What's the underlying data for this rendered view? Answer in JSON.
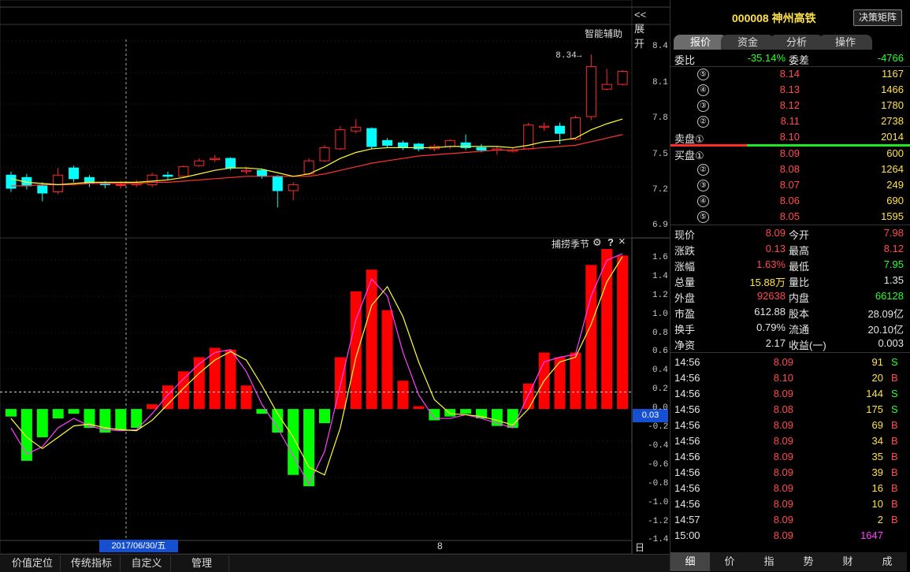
{
  "top_panel": {
    "expand_label": "<<展开",
    "assist_label": "智能辅助",
    "high_marker": "8.34"
  },
  "indicator": {
    "name": "捕捞季节",
    "gear_icon": "gear-icon",
    "help": "?",
    "close": "×",
    "current_value": "0.03"
  },
  "date_label": "2017/06/30/五",
  "axis_mid_label": "8",
  "period_label": "日 线",
  "bottom_tabs": [
    "价值定位",
    "传统指标",
    "自定义",
    "管理"
  ],
  "chart_data": [
    {
      "type": "candlestick",
      "y_ticks": [
        "8.4",
        "8.1",
        "7.8",
        "7.5",
        "7.2",
        "6.9"
      ],
      "ylim": [
        6.85,
        8.5
      ],
      "annotation": "8.34",
      "candles": [
        {
          "o": 7.33,
          "c": 7.22,
          "h": 7.36,
          "l": 7.19
        },
        {
          "o": 7.31,
          "c": 7.24,
          "h": 7.34,
          "l": 7.21
        },
        {
          "o": 7.24,
          "c": 7.18,
          "h": 7.27,
          "l": 7.11
        },
        {
          "o": 7.19,
          "c": 7.33,
          "h": 7.39,
          "l": 7.17
        },
        {
          "o": 7.39,
          "c": 7.3,
          "h": 7.41,
          "l": 7.27
        },
        {
          "o": 7.31,
          "c": 7.26,
          "h": 7.33,
          "l": 7.23
        },
        {
          "o": 7.26,
          "c": 7.25,
          "h": 7.28,
          "l": 7.22
        },
        {
          "o": 7.25,
          "c": 7.25,
          "h": 7.28,
          "l": 7.22
        },
        {
          "o": 7.25,
          "c": 7.26,
          "h": 7.29,
          "l": 7.23
        },
        {
          "o": 7.25,
          "c": 7.33,
          "h": 7.35,
          "l": 7.23
        },
        {
          "o": 7.33,
          "c": 7.32,
          "h": 7.36,
          "l": 7.29
        },
        {
          "o": 7.32,
          "c": 7.4,
          "h": 7.41,
          "l": 7.31
        },
        {
          "o": 7.41,
          "c": 7.45,
          "h": 7.47,
          "l": 7.4
        },
        {
          "o": 7.46,
          "c": 7.47,
          "h": 7.5,
          "l": 7.44
        },
        {
          "o": 7.47,
          "c": 7.39,
          "h": 7.48,
          "l": 7.37
        },
        {
          "o": 7.36,
          "c": 7.37,
          "h": 7.4,
          "l": 7.34
        },
        {
          "o": 7.37,
          "c": 7.32,
          "h": 7.38,
          "l": 7.3
        },
        {
          "o": 7.32,
          "c": 7.2,
          "h": 7.33,
          "l": 7.06
        },
        {
          "o": 7.2,
          "c": 7.25,
          "h": 7.27,
          "l": 7.12
        },
        {
          "o": 7.34,
          "c": 7.45,
          "h": 7.47,
          "l": 7.33
        },
        {
          "o": 7.45,
          "c": 7.56,
          "h": 7.58,
          "l": 7.44
        },
        {
          "o": 7.55,
          "c": 7.71,
          "h": 7.74,
          "l": 7.54
        },
        {
          "o": 7.7,
          "c": 7.73,
          "h": 7.8,
          "l": 7.68
        },
        {
          "o": 7.72,
          "c": 7.57,
          "h": 7.73,
          "l": 7.55
        },
        {
          "o": 7.62,
          "c": 7.58,
          "h": 7.64,
          "l": 7.56
        },
        {
          "o": 7.6,
          "c": 7.56,
          "h": 7.62,
          "l": 7.54
        },
        {
          "o": 7.59,
          "c": 7.55,
          "h": 7.6,
          "l": 7.53
        },
        {
          "o": 7.55,
          "c": 7.57,
          "h": 7.59,
          "l": 7.53
        },
        {
          "o": 7.57,
          "c": 7.62,
          "h": 7.63,
          "l": 7.55
        },
        {
          "o": 7.6,
          "c": 7.56,
          "h": 7.67,
          "l": 7.54
        },
        {
          "o": 7.56,
          "c": 7.54,
          "h": 7.59,
          "l": 7.52
        },
        {
          "o": 7.54,
          "c": 7.55,
          "h": 7.57,
          "l": 7.5
        },
        {
          "o": 7.53,
          "c": 7.54,
          "h": 7.56,
          "l": 7.52
        },
        {
          "o": 7.55,
          "c": 7.75,
          "h": 7.77,
          "l": 7.54
        },
        {
          "o": 7.73,
          "c": 7.74,
          "h": 7.77,
          "l": 7.7
        },
        {
          "o": 7.74,
          "c": 7.68,
          "h": 7.77,
          "l": 7.59
        },
        {
          "o": 7.63,
          "c": 7.81,
          "h": 7.83,
          "l": 7.62
        },
        {
          "o": 7.82,
          "c": 8.24,
          "h": 8.34,
          "l": 7.79
        },
        {
          "o": 8.05,
          "c": 8.09,
          "h": 8.22,
          "l": 8.04
        },
        {
          "o": 8.09,
          "c": 8.2,
          "h": 8.21,
          "l": 8.08
        }
      ],
      "ma_short": [
        7.3,
        7.27,
        7.26,
        7.25,
        7.26,
        7.27,
        7.27,
        7.27,
        7.27,
        7.28,
        7.29,
        7.31,
        7.34,
        7.37,
        7.39,
        7.39,
        7.38,
        7.35,
        7.32,
        7.34,
        7.4,
        7.47,
        7.52,
        7.55,
        7.56,
        7.56,
        7.56,
        7.56,
        7.57,
        7.57,
        7.57,
        7.57,
        7.56,
        7.58,
        7.61,
        7.62,
        7.64,
        7.71,
        7.76,
        7.8
      ],
      "ma_long": [
        7.24,
        7.24,
        7.25,
        7.25,
        7.25,
        7.26,
        7.26,
        7.26,
        7.26,
        7.27,
        7.27,
        7.28,
        7.29,
        7.3,
        7.31,
        7.32,
        7.32,
        7.32,
        7.32,
        7.32,
        7.34,
        7.37,
        7.4,
        7.43,
        7.45,
        7.47,
        7.49,
        7.5,
        7.51,
        7.52,
        7.53,
        7.54,
        7.54,
        7.55,
        7.56,
        7.57,
        7.58,
        7.61,
        7.64,
        7.67
      ]
    },
    {
      "type": "bar",
      "y_ticks": [
        "1.6",
        "1.4",
        "1.2",
        "1.0",
        "0.8",
        "0.6",
        "0.4",
        "0.2",
        "0.0",
        "-0.2",
        "-0.4",
        "-0.6",
        "-0.8",
        "-1.0",
        "-1.2",
        "-1.4"
      ],
      "ylim": [
        -1.43,
        1.75
      ],
      "reference_line": 0.18,
      "values": [
        -0.08,
        -0.55,
        -0.3,
        -0.1,
        -0.05,
        -0.2,
        -0.25,
        -0.22,
        -0.2,
        0.05,
        0.25,
        0.4,
        0.55,
        0.65,
        0.63,
        0.25,
        -0.05,
        -0.25,
        -0.7,
        -0.82,
        -0.15,
        0.55,
        1.25,
        1.48,
        1.05,
        0.3,
        0.03,
        -0.12,
        -0.08,
        -0.05,
        -0.1,
        -0.18,
        -0.2,
        0.27,
        0.6,
        0.55,
        0.6,
        1.53,
        1.7,
        1.63
      ],
      "line_a": [
        -0.2,
        -0.48,
        -0.4,
        -0.2,
        -0.1,
        -0.18,
        -0.22,
        -0.23,
        -0.22,
        -0.05,
        0.15,
        0.32,
        0.48,
        0.6,
        0.63,
        0.4,
        0.05,
        -0.2,
        -0.5,
        -0.8,
        -0.45,
        0.25,
        0.95,
        1.38,
        1.2,
        0.6,
        0.15,
        -0.1,
        -0.1,
        -0.06,
        -0.1,
        -0.15,
        -0.2,
        0.15,
        0.5,
        0.55,
        0.58,
        1.2,
        1.58,
        1.65
      ],
      "line_b": [
        -0.1,
        -0.3,
        -0.42,
        -0.3,
        -0.18,
        -0.16,
        -0.2,
        -0.22,
        -0.23,
        -0.12,
        0.05,
        0.22,
        0.38,
        0.52,
        0.61,
        0.52,
        0.25,
        -0.05,
        -0.3,
        -0.62,
        -0.7,
        -0.2,
        0.55,
        1.1,
        1.3,
        0.98,
        0.5,
        0.1,
        -0.05,
        -0.06,
        -0.08,
        -0.12,
        -0.17,
        0.0,
        0.3,
        0.5,
        0.55,
        0.9,
        1.35,
        1.62
      ]
    }
  ],
  "quote": {
    "code": "000008",
    "name": "神州高铁",
    "decision_btn": "决策矩阵",
    "tabs": [
      "报价",
      "资金",
      "分析",
      "操作"
    ],
    "weibi_label": "委比",
    "weibi_value": "-35.14%",
    "weicha_label": "委差",
    "weicha_value": "-4766",
    "sell": [
      {
        "level": "⑤",
        "price": "8.14",
        "vol": "1167"
      },
      {
        "level": "④",
        "price": "8.13",
        "vol": "1466"
      },
      {
        "level": "③",
        "price": "8.12",
        "vol": "1780"
      },
      {
        "level": "②",
        "price": "8.11",
        "vol": "2738"
      },
      {
        "level": "卖盘①",
        "price": "8.10",
        "vol": "2014"
      }
    ],
    "buy": [
      {
        "level": "买盘①",
        "price": "8.09",
        "vol": "600"
      },
      {
        "level": "②",
        "price": "8.08",
        "vol": "1264"
      },
      {
        "level": "③",
        "price": "8.07",
        "vol": "249"
      },
      {
        "level": "④",
        "price": "8.06",
        "vol": "690"
      },
      {
        "level": "⑤",
        "price": "8.05",
        "vol": "1595"
      }
    ],
    "stats": [
      {
        "l1": "现价",
        "v1": "8.09",
        "c1": "red",
        "l2": "今开",
        "v2": "7.98",
        "c2": "red"
      },
      {
        "l1": "涨跌",
        "v1": "0.13",
        "c1": "red",
        "l2": "最高",
        "v2": "8.12",
        "c2": "red"
      },
      {
        "l1": "涨幅",
        "v1": "1.63%",
        "c1": "red",
        "l2": "最低",
        "v2": "7.95",
        "c2": "green"
      },
      {
        "l1": "总量",
        "v1": "15.88万",
        "c1": "yellow",
        "l2": "量比",
        "v2": "1.35",
        "c2": "white"
      },
      {
        "l1": "外盘",
        "v1": "92638",
        "c1": "red",
        "l2": "内盘",
        "v2": "66128",
        "c2": "green"
      },
      {
        "l1": "市盈",
        "v1": "612.88",
        "c1": "white",
        "l2": "股本",
        "v2": "28.09亿",
        "c2": "white"
      },
      {
        "l1": "换手",
        "v1": "0.79%",
        "c1": "white",
        "l2": "流通",
        "v2": "20.10亿",
        "c2": "white"
      },
      {
        "l1": "净资",
        "v1": "2.17",
        "c1": "white",
        "l2": "收益(一)",
        "v2": "0.003",
        "c2": "white"
      }
    ],
    "ticks": [
      {
        "t": "14:56",
        "p": "8.09",
        "v": "91",
        "s": "S"
      },
      {
        "t": "14:56",
        "p": "8.10",
        "v": "20",
        "s": "B"
      },
      {
        "t": "14:56",
        "p": "8.09",
        "v": "144",
        "s": "S"
      },
      {
        "t": "14:56",
        "p": "8.08",
        "v": "175",
        "s": "S"
      },
      {
        "t": "14:56",
        "p": "8.09",
        "v": "69",
        "s": "B"
      },
      {
        "t": "14:56",
        "p": "8.09",
        "v": "34",
        "s": "B"
      },
      {
        "t": "14:56",
        "p": "8.09",
        "v": "35",
        "s": "B"
      },
      {
        "t": "14:56",
        "p": "8.09",
        "v": "39",
        "s": "B"
      },
      {
        "t": "14:56",
        "p": "8.09",
        "v": "16",
        "s": "B"
      },
      {
        "t": "14:56",
        "p": "8.09",
        "v": "10",
        "s": "B"
      },
      {
        "t": "14:57",
        "p": "8.09",
        "v": "2",
        "s": "B"
      },
      {
        "t": "15:00",
        "p": "8.09",
        "v": "1647",
        "s": ""
      }
    ],
    "bottom_tabs": [
      "细",
      "价",
      "指",
      "势",
      "财",
      "成"
    ]
  },
  "colors": {
    "up": "#ff2a2a",
    "down": "#00ffff",
    "bar_up": "#ff0000",
    "bar_down": "#00ff00",
    "ma_short": "#ffff33",
    "ma_long": "#ff3333",
    "line_a": "#ff40ff",
    "line_b": "#ffff33"
  }
}
